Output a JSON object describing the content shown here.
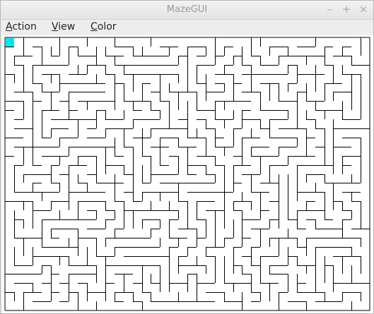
{
  "window": {
    "title": "MazeGUI",
    "minimize_glyph": "–",
    "maximize_glyph": "+",
    "close_glyph": "×"
  },
  "menubar": {
    "items": [
      {
        "label": "Action",
        "mnemonic": "A"
      },
      {
        "label": "View",
        "mnemonic": "V"
      },
      {
        "label": "Color",
        "mnemonic": "C"
      }
    ]
  },
  "maze": {
    "columns": 40,
    "rows": 30,
    "wall_color": "#000000",
    "background_color": "#ffffff",
    "player_color": "#00e5ee",
    "player_cell": {
      "col": 0,
      "row": 0
    }
  }
}
